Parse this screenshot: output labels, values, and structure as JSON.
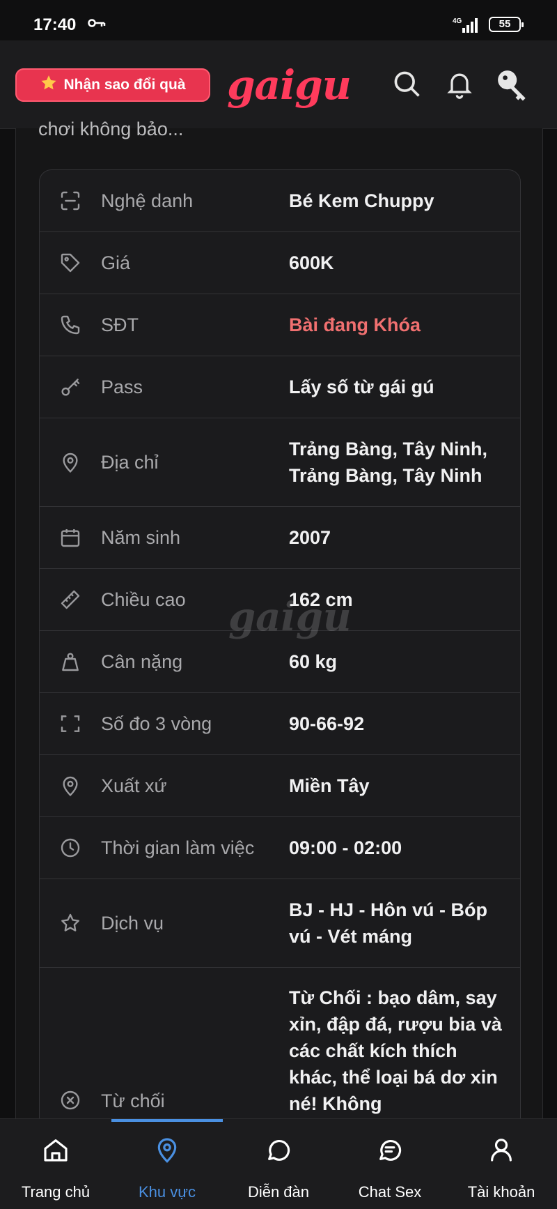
{
  "status_bar": {
    "time": "17:40",
    "network": "4G",
    "battery": "55"
  },
  "header": {
    "promo_label": "Nhận sao đổi quà",
    "logo_text": "gaigu"
  },
  "truncated_text": "chơi không bảo...",
  "watermark": "gaigu",
  "details": [
    {
      "label": "Nghệ danh",
      "value": "Bé Kem Chuppy",
      "icon": "scan-icon"
    },
    {
      "label": "Giá",
      "value": "600K",
      "icon": "tag-icon"
    },
    {
      "label": "SĐT",
      "value": "Bài đang Khóa",
      "icon": "phone-icon"
    },
    {
      "label": "Pass",
      "value": "Lấy số từ gái gú",
      "icon": "key-icon"
    },
    {
      "label": "Địa chỉ",
      "value": "Trảng Bàng, Tây Ninh, Trảng Bàng, Tây Ninh",
      "icon": "map-pin-icon"
    },
    {
      "label": "Năm sinh",
      "value": "2007",
      "icon": "calendar-icon"
    },
    {
      "label": "Chiều cao",
      "value": "162 cm",
      "icon": "ruler-icon"
    },
    {
      "label": "Cân nặng",
      "value": "60 kg",
      "icon": "weight-icon"
    },
    {
      "label": "Số đo 3 vòng",
      "value": "90-66-92",
      "icon": "frame-icon"
    },
    {
      "label": "Xuất xứ",
      "value": "Miền Tây",
      "icon": "map-pin-icon"
    },
    {
      "label": "Thời gian làm việc",
      "value": "09:00 - 02:00",
      "icon": "clock-icon"
    },
    {
      "label": "Dịch vụ",
      "value": "BJ - HJ - Hôn vú - Bóp vú - Vét máng",
      "icon": "star-icon"
    },
    {
      "label": "Từ chối",
      "value": "Từ Chối : bạo dâm, say xỉn, đập đá, rượu bia và các chất kích thích khác, thể loại bá dơ xin né! Không",
      "icon": "x-circle-icon"
    }
  ],
  "nav": {
    "items": [
      {
        "label": "Trang chủ"
      },
      {
        "label": "Khu vực"
      },
      {
        "label": "Diễn đàn"
      },
      {
        "label": "Chat Sex"
      },
      {
        "label": "Tài khoản"
      }
    ]
  },
  "colors": {
    "accent": "#e8344f",
    "logo": "#ff3b5c",
    "nav_active": "#4a90e2",
    "locked_value": "#f07070"
  }
}
